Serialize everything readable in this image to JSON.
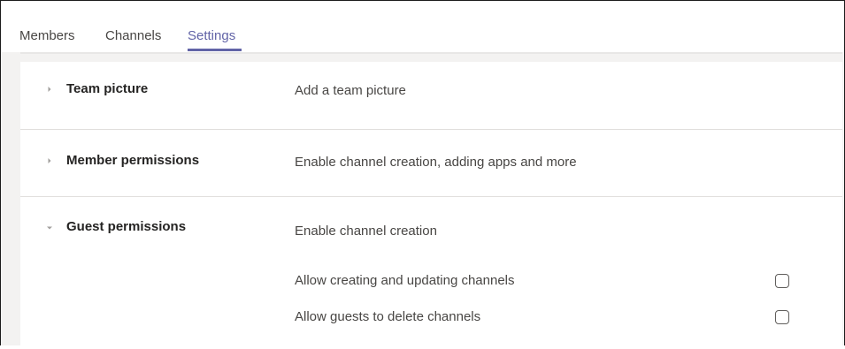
{
  "tabs": [
    {
      "label": "Members",
      "active": false
    },
    {
      "label": "Channels",
      "active": false
    },
    {
      "label": "Settings",
      "active": true
    }
  ],
  "sections": [
    {
      "title": "Team picture",
      "description": "Add a team picture",
      "expanded": false,
      "icon": "chevron-right-icon"
    },
    {
      "title": "Member permissions",
      "description": "Enable channel creation, adding apps and more",
      "expanded": false,
      "icon": "chevron-right-icon"
    },
    {
      "title": "Guest permissions",
      "description": "Enable channel creation",
      "expanded": true,
      "icon": "chevron-down-icon"
    }
  ],
  "guest_options": [
    {
      "label": "Allow creating and updating channels",
      "checked": false
    },
    {
      "label": "Allow guests to delete channels",
      "checked": false
    }
  ],
  "colors": {
    "accent": "#6264a7",
    "text": "#484644",
    "title": "#252423",
    "divider": "#e1dfdd",
    "background": "#f3f2f1"
  }
}
